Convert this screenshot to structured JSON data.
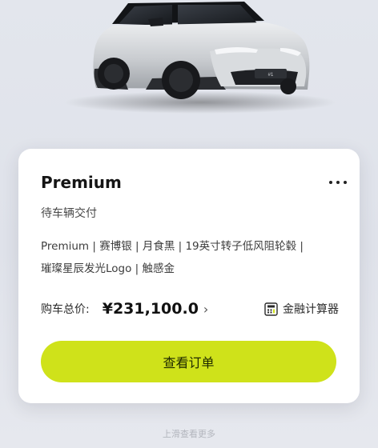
{
  "order_card": {
    "title": "Premium",
    "status": "待车辆交付",
    "config_line1": "Premium | 赛博银 | 月食黑 | 19英寸转子低风阻轮毂 |",
    "config_line2": "璀璨星辰发光Logo | 触感金",
    "price_label": "购车总价:",
    "price_value": "¥231,100.0",
    "calculator_label": "金融计算器",
    "view_order_label": "查看订单"
  },
  "footer": {
    "hint": "上滑查看更多"
  },
  "colors": {
    "accent_button": "#cfe21a",
    "card_bg": "#ffffff",
    "page_bg": "#e3e6ed"
  }
}
